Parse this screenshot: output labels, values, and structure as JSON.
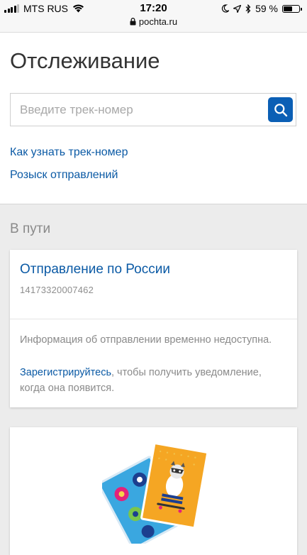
{
  "status_bar": {
    "carrier": "MTS RUS",
    "time": "17:20",
    "url": "pochta.ru",
    "battery": "59 %",
    "battery_level": 0.59
  },
  "header": {
    "title": "Отслеживание"
  },
  "search": {
    "placeholder": "Введите трек-номер",
    "value": ""
  },
  "links": {
    "how_to_find": "Как узнать трек-номер",
    "search_shipments": "Розыск отправлений"
  },
  "section": {
    "title": "В пути"
  },
  "shipment_card": {
    "title": "Отправление по России",
    "track_number": "14173320007462",
    "info": "Информация об отправлении временно недоступна.",
    "register_link": "Зарегистрируйтесь",
    "register_suffix": ", чтобы получить уведомление, когда она появится."
  },
  "colors": {
    "accent": "#0b5fb5",
    "link": "#0b5aa5",
    "background": "#ececec"
  },
  "icons": [
    "signal-icon",
    "wifi-icon",
    "lock-icon",
    "moon-icon",
    "location-arrow-icon",
    "bluetooth-icon",
    "battery-icon",
    "search-icon"
  ]
}
